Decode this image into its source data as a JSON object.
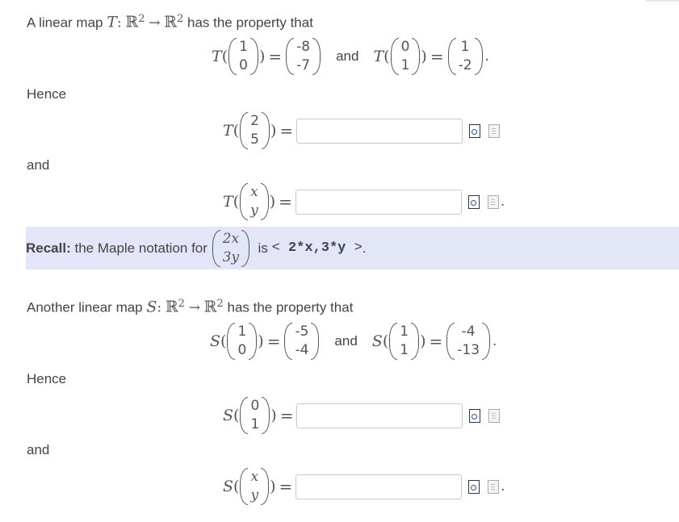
{
  "problem": {
    "intro_T": {
      "prefix": "A linear map",
      "map": "T",
      "colon": ":",
      "domain": "ℝ",
      "exp": "2",
      "arrow": "→",
      "codomain": "ℝ",
      "exp2": "2",
      "suffix": "has the property that"
    },
    "given_T": [
      {
        "fn": "T",
        "input": [
          "1",
          "0"
        ],
        "output": [
          "-8",
          "-7"
        ]
      },
      {
        "fn": "T",
        "input": [
          "0",
          "1"
        ],
        "output": [
          "1",
          "-2"
        ]
      }
    ],
    "and_word": "and",
    "hence": "Hence",
    "asks_T": [
      {
        "fn": "T",
        "input": [
          "2",
          "5"
        ],
        "value": ""
      },
      {
        "fn": "T",
        "input": [
          "x",
          "y"
        ],
        "value": ""
      }
    ],
    "recall": {
      "bold": "Recall:",
      "text": "the Maple notation for",
      "vector": [
        "2x",
        "3y"
      ],
      "is": "is",
      "code_lt": "<",
      "code_body": "2*x,3*y",
      "code_gt": ">",
      "end": "."
    },
    "intro_S": {
      "prefix": "Another linear map",
      "map": "S",
      "colon": ":",
      "domain": "ℝ",
      "exp": "2",
      "arrow": "→",
      "codomain": "ℝ",
      "exp2": "2",
      "suffix": "has the property that"
    },
    "given_S": [
      {
        "fn": "S",
        "input": [
          "1",
          "0"
        ],
        "output": [
          "-5",
          "-4"
        ]
      },
      {
        "fn": "S",
        "input": [
          "1",
          "1"
        ],
        "output": [
          "-4",
          "-13"
        ]
      }
    ],
    "asks_S": [
      {
        "fn": "S",
        "input": [
          "0",
          "1"
        ],
        "value": ""
      },
      {
        "fn": "S",
        "input": [
          "x",
          "y"
        ],
        "value": ""
      }
    ],
    "icons": [
      "preview-icon",
      "help-icon"
    ]
  }
}
